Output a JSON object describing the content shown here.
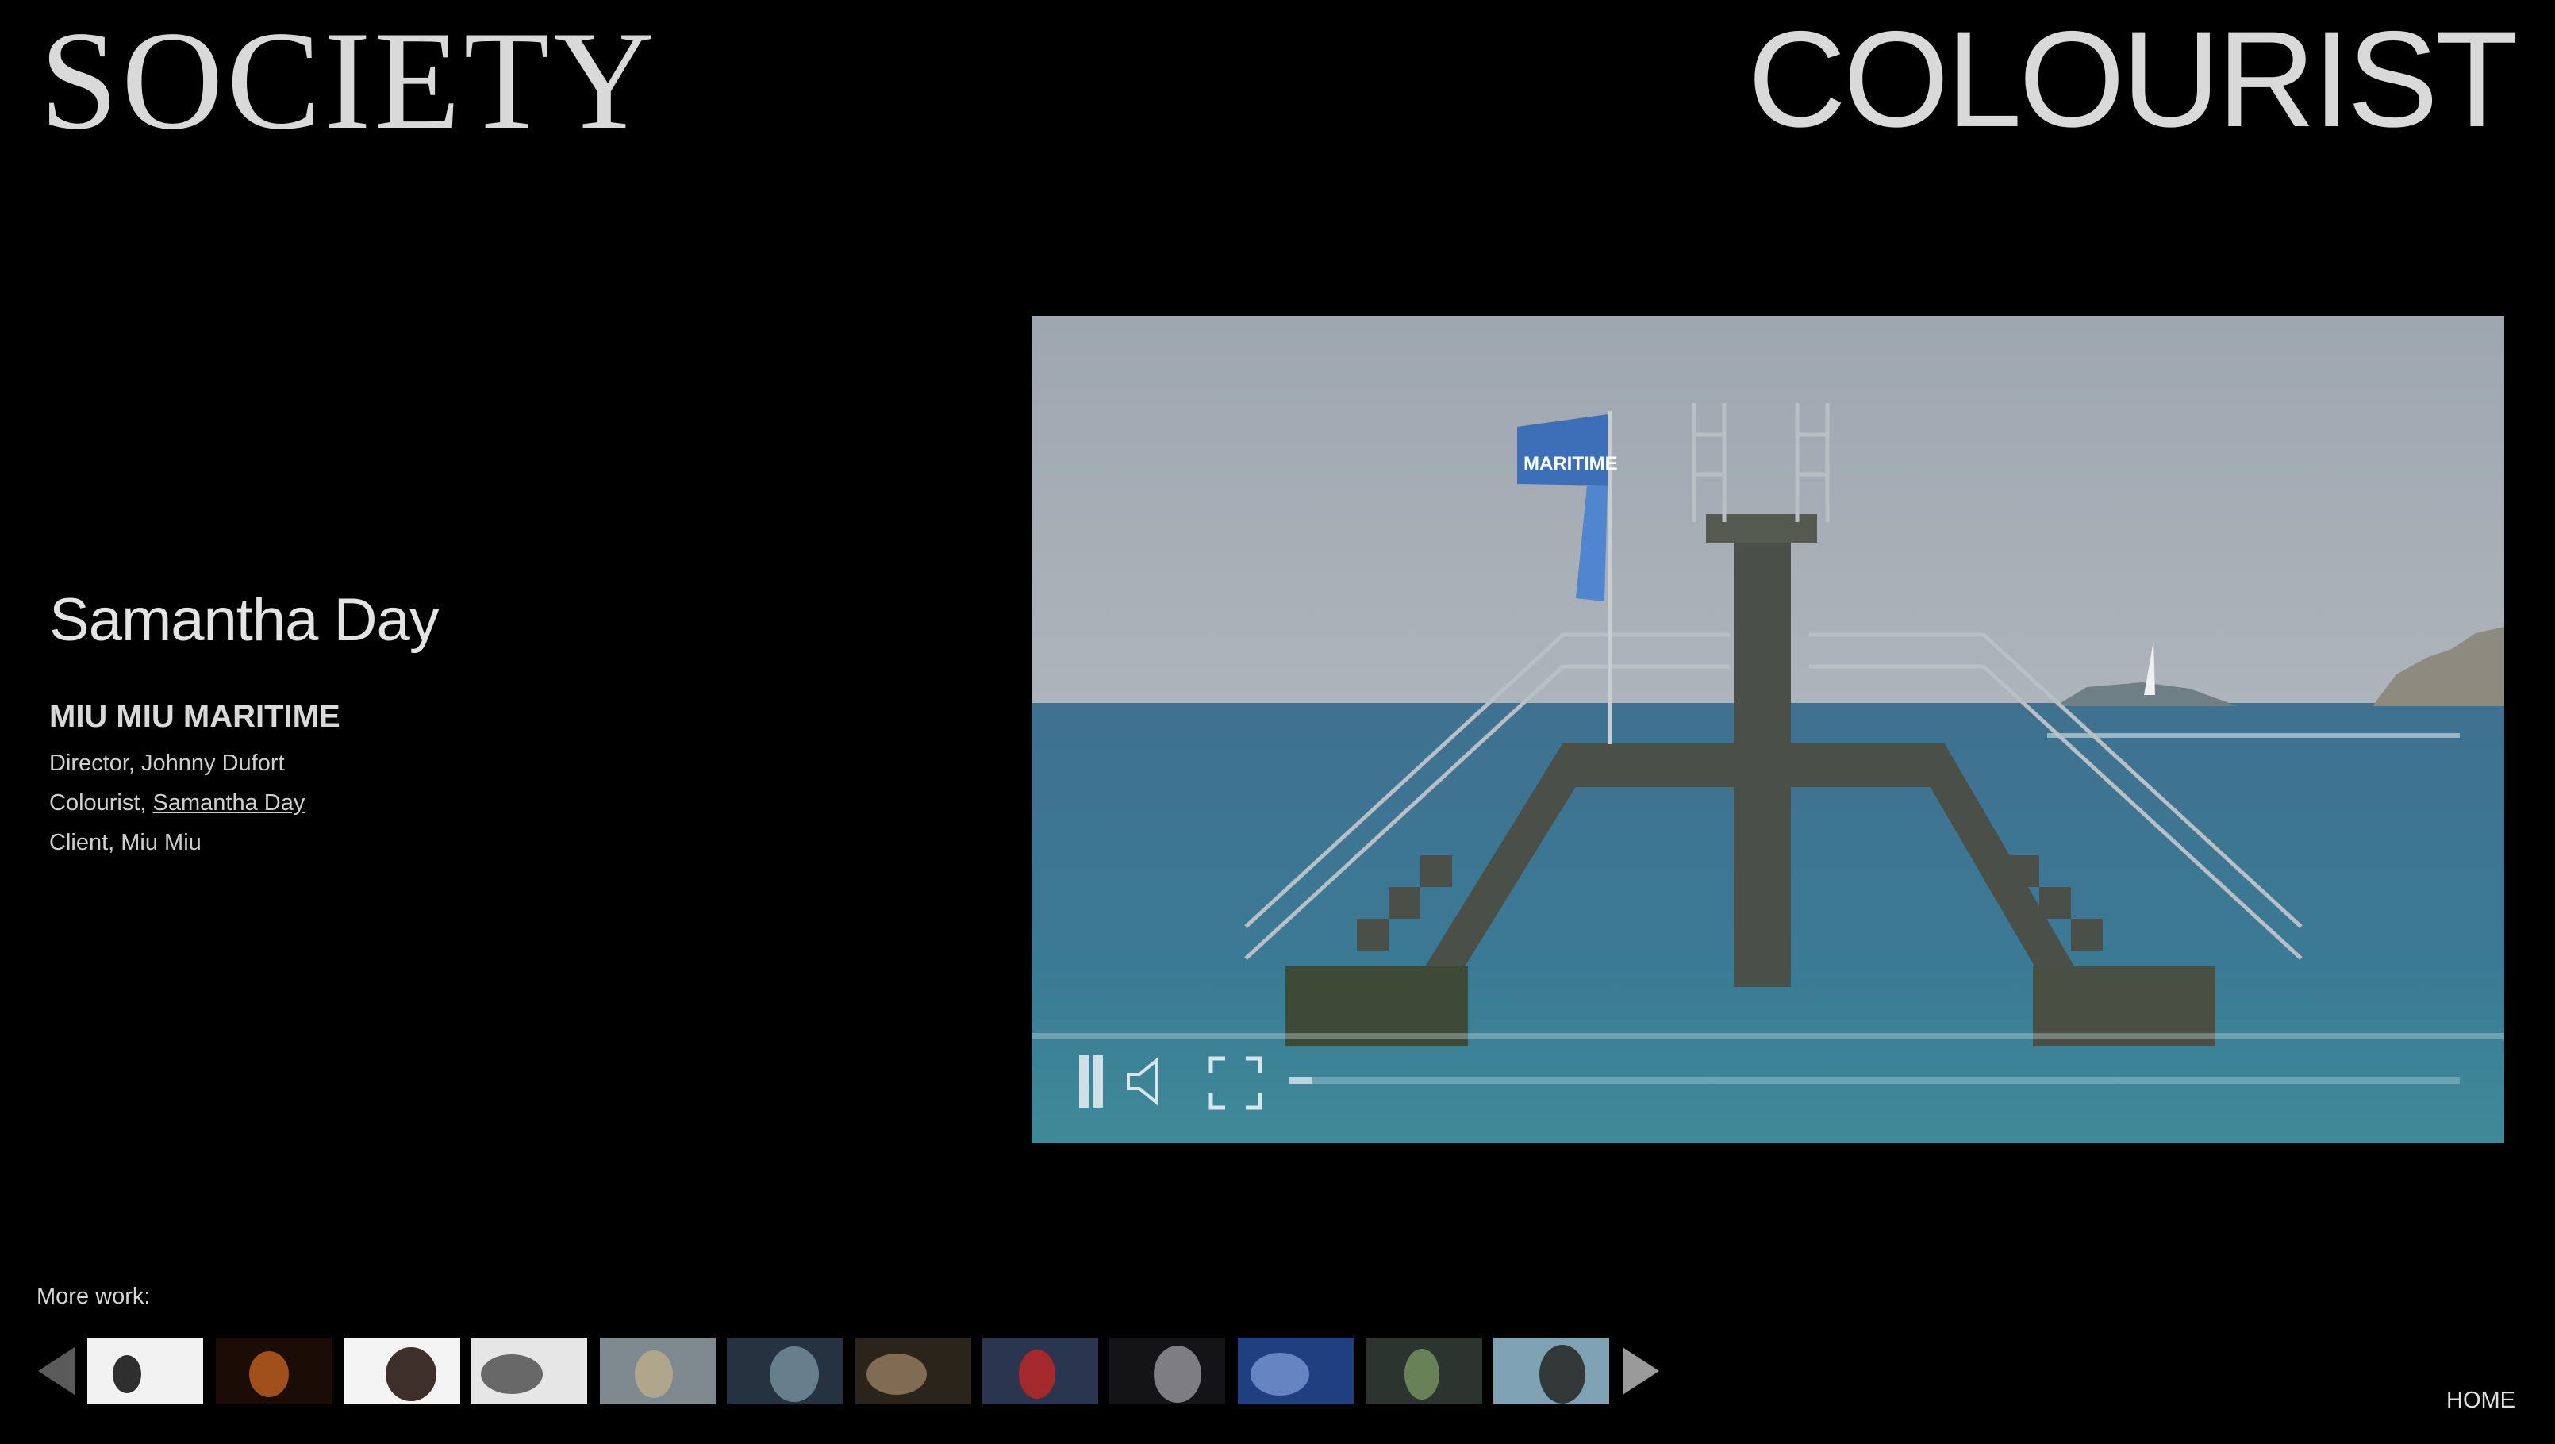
{
  "header": {
    "brand_left": "SOCIETY",
    "brand_right": "COLOURIST"
  },
  "project": {
    "person": "Samantha Day",
    "title": "MIU MIU MARITIME",
    "credits": {
      "director_prefix": "Director, ",
      "director": "Johnny Dufort",
      "colourist_prefix": "Colourist, ",
      "colourist": "Samantha Day",
      "client_prefix": "Client, ",
      "client": "Miu Miu"
    }
  },
  "video": {
    "flag_text": "MARITIME",
    "playing": true,
    "progress": 0.02,
    "controls": {
      "pause": "pause-icon",
      "mute": "speaker-icon",
      "fullscreen": "fullscreen-icon"
    }
  },
  "more_work": {
    "label": "More work:",
    "thumbnails": [
      {
        "theme": "white",
        "bg": "#f2f2f2",
        "fg": "#1a1a1a"
      },
      {
        "theme": "fire",
        "bg": "#1b0d05",
        "fg": "#b0561e"
      },
      {
        "theme": "portrait-profile",
        "bg": "#f4f4f4",
        "fg": "#2a1a14"
      },
      {
        "theme": "bw-figure",
        "bg": "#e6e6e6",
        "fg": "#5a5a5a"
      },
      {
        "theme": "landscape",
        "bg": "#7f8a90",
        "fg": "#b5a98c"
      },
      {
        "theme": "water-figure",
        "bg": "#24333f",
        "fg": "#6f8696"
      },
      {
        "theme": "dark-portrait",
        "bg": "#2a241a",
        "fg": "#8a735a"
      },
      {
        "theme": "red-abstract",
        "bg": "#2a3550",
        "fg": "#b02828"
      },
      {
        "theme": "dark-light",
        "bg": "#141416",
        "fg": "#8a8a8e"
      },
      {
        "theme": "blue-figure",
        "bg": "#1f3f80",
        "fg": "#6d8cc8"
      },
      {
        "theme": "stairs-green",
        "bg": "#2c3430",
        "fg": "#6f8a5c"
      },
      {
        "theme": "maritime",
        "bg": "#7fa2b5",
        "fg": "#2b2e2a"
      }
    ]
  },
  "nav": {
    "home": "HOME"
  }
}
